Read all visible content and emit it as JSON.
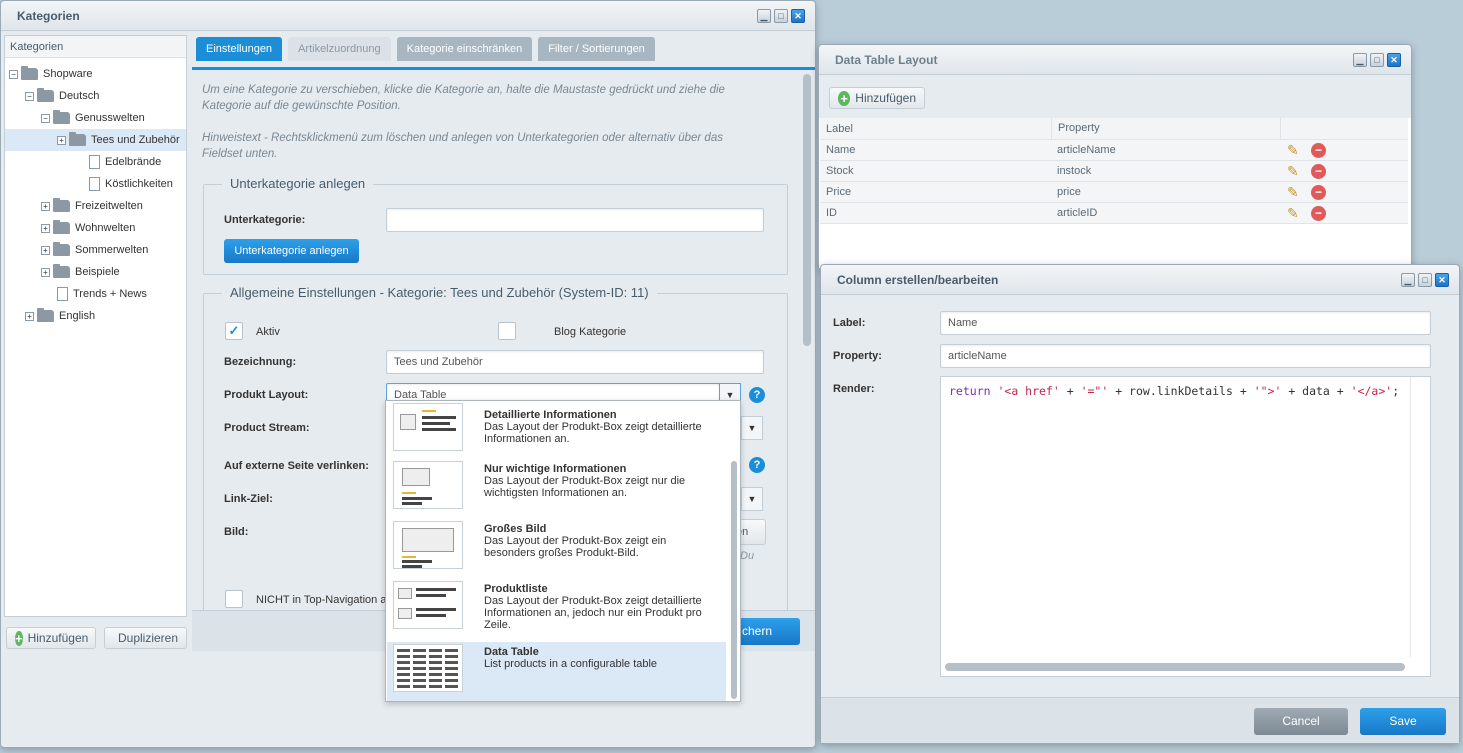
{
  "kategorien_window": {
    "title": "Kategorien",
    "tree_header": "Kategorien",
    "tree": [
      {
        "label": "Shopware",
        "toggle": "−",
        "icon": "folder"
      },
      {
        "label": "Deutsch",
        "toggle": "−",
        "icon": "folder"
      },
      {
        "label": "Genusswelten",
        "toggle": "−",
        "icon": "folder"
      },
      {
        "label": "Tees und Zubehör",
        "toggle": "+",
        "icon": "folder",
        "selected": true
      },
      {
        "label": "Edelbrände",
        "toggle": "",
        "icon": "document"
      },
      {
        "label": "Köstlichkeiten",
        "toggle": "",
        "icon": "document"
      },
      {
        "label": "Freizeitwelten",
        "toggle": "+",
        "icon": "folder"
      },
      {
        "label": "Wohnwelten",
        "toggle": "+",
        "icon": "folder"
      },
      {
        "label": "Sommerwelten",
        "toggle": "+",
        "icon": "folder"
      },
      {
        "label": "Beispiele",
        "toggle": "+",
        "icon": "folder"
      },
      {
        "label": "Trends + News",
        "toggle": "",
        "icon": "document"
      },
      {
        "label": "English",
        "toggle": "+",
        "icon": "folder"
      }
    ],
    "add_button": "Hinzufügen",
    "duplicate_button": "Duplizieren",
    "tabs": [
      {
        "label": "Einstellungen",
        "state": "active"
      },
      {
        "label": "Artikelzuordnung",
        "state": "disabled"
      },
      {
        "label": "Kategorie einschränken",
        "state": "normal"
      },
      {
        "label": "Filter / Sortierungen",
        "state": "normal"
      }
    ],
    "hint1": "Um eine Kategorie zu verschieben, klicke die Kategorie an, halte die Maustaste gedrückt und ziehe die Kategorie auf die gewünschte Position.",
    "hint2": "Hinweistext - Rechtsklickmenü zum löschen und anlegen von Unterkategorien oder alternativ über das Fieldset unten.",
    "sub_fieldset": {
      "legend": "Unterkategorie anlegen",
      "label": "Unterkategorie:",
      "value": "",
      "button": "Unterkategorie anlegen"
    },
    "general_fieldset": {
      "legend": "Allgemeine Einstellungen - Kategorie: Tees und Zubehör (System-ID: 11)",
      "aktiv_label": "Aktiv",
      "aktiv_checked": "✓",
      "blog_label": "Blog Kategorie",
      "bezeichnung_label": "Bezeichnung:",
      "bezeichnung_value": "Tees und Zubehör",
      "layout_label": "Produkt Layout:",
      "layout_value": "Data Table",
      "stream_label": "Product Stream:",
      "extern_label": "Auf externe Seite verlinken:",
      "linkziel_label": "Link-Ziel:",
      "bild_label": "Bild:",
      "bild_button_fragment": "en",
      "bild_text_fragment": "Du",
      "topnav_label": "NICHT in Top-Navigation a",
      "help": "?"
    },
    "save_fragment": "chern"
  },
  "layout_dropdown": [
    {
      "title": "Detaillierte Informationen",
      "desc": "Das Layout der Produkt-Box zeigt detaillierte Informationen an.",
      "thumb": "detail-layout-thumbnail"
    },
    {
      "title": "Nur wichtige Informationen",
      "desc": "Das Layout der Produkt-Box zeigt nur die wichtigsten Informationen an.",
      "thumb": "basic-layout-thumbnail"
    },
    {
      "title": "Großes Bild",
      "desc": "Das Layout der Produkt-Box zeigt ein besonders großes Produkt-Bild.",
      "thumb": "big-image-layout-thumbnail"
    },
    {
      "title": "Produktliste",
      "desc": "Das Layout der Produkt-Box zeigt detaillierte Informationen an, jedoch nur ein Produkt pro Zeile.",
      "thumb": "list-layout-thumbnail"
    },
    {
      "title": "Data Table",
      "desc": "List products in a configurable table",
      "thumb": "data-table-layout-thumbnail",
      "selected": true
    }
  ],
  "data_table_window": {
    "title": "Data Table Layout",
    "add_button": "Hinzufügen",
    "columns": [
      "Label",
      "Property"
    ],
    "rows": [
      {
        "label": "Name",
        "property": "articleName"
      },
      {
        "label": "Stock",
        "property": "instock"
      },
      {
        "label": "Price",
        "property": "price"
      },
      {
        "label": "ID",
        "property": "articleID"
      }
    ]
  },
  "column_window": {
    "title": "Column erstellen/bearbeiten",
    "label_label": "Label:",
    "label_value": "Name",
    "property_label": "Property:",
    "property_value": "articleName",
    "render_label": "Render:",
    "render_code": [
      {
        "text": "return",
        "color": "#7b2fb3"
      },
      {
        "text": " '<a href'",
        "color": "#c7254e"
      },
      {
        "text": " + ",
        "color": "#333333"
      },
      {
        "text": "'=\"'",
        "color": "#c7254e"
      },
      {
        "text": " + row.linkDetails + ",
        "color": "#333333"
      },
      {
        "text": "'\">'",
        "color": "#c7254e"
      },
      {
        "text": " + data + ",
        "color": "#333333"
      },
      {
        "text": "'</a>'",
        "color": "#c7254e"
      },
      {
        "text": ";",
        "color": "#333333"
      }
    ],
    "cancel_button": "Cancel",
    "save_button": "Save"
  }
}
